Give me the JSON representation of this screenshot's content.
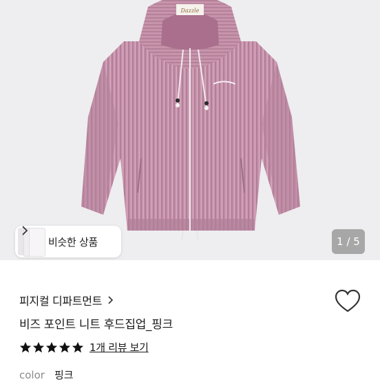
{
  "gallery": {
    "brand_tag": "Dazzle",
    "similar_products_label": "비슷한 상품",
    "image_index": "1 / 5",
    "product_color": "#c994ad"
  },
  "product": {
    "shop_name": "피지컬 디파트먼트",
    "title": "비즈 포인트 니트 후드집업_핑크",
    "rating": 5,
    "review_link": "1개 리뷰 보기",
    "color_label": "color",
    "color_value": "핑크"
  },
  "icons": {
    "heart": "heart-outline-icon",
    "shop_chevron": "chevron-right-icon",
    "star": "star-filled-icon"
  }
}
